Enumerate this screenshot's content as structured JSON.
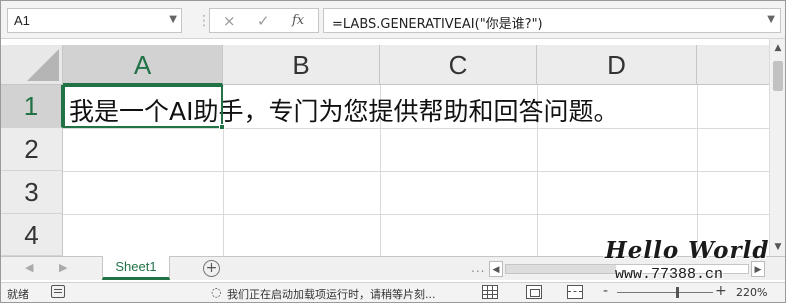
{
  "formula_bar": {
    "name_box": "A1",
    "cancel_icon": "×",
    "enter_icon": "✓",
    "fx_label": "fx",
    "formula": "=LABS.GENERATIVEAI(\"你是谁?\")"
  },
  "columns": [
    "A",
    "B",
    "C",
    "D"
  ],
  "rows": [
    "1",
    "2",
    "3",
    "4"
  ],
  "selected_cell": {
    "column": "A",
    "row": "1"
  },
  "cells": {
    "A1": "我是一个AI助手，专门为您提供帮助和回答问题。"
  },
  "sheet_tabs": {
    "active": "Sheet1",
    "add_label": "+",
    "overflow_label": "..."
  },
  "watermark": {
    "line1": "Hello World",
    "line2": "www.77388.cn"
  },
  "status_bar": {
    "ready": "就绪",
    "message": "我们正在启动加载项运行时，请稍等片刻...",
    "zoom_minus": "-",
    "zoom_plus": "+",
    "zoom": "220%",
    "zoom_fraction": 0.62
  },
  "colors": {
    "accent": "#217346",
    "header_bg": "#ececec",
    "gridline": "#dadada"
  },
  "icons": {
    "name_box_dropdown": "chevron-down-icon",
    "cancel": "close-icon",
    "enter": "checkmark-icon",
    "function": "fx-icon",
    "add_sheet": "plus-circle-icon",
    "accessibility": "accessibility-icon",
    "status_message": "info-icon"
  }
}
